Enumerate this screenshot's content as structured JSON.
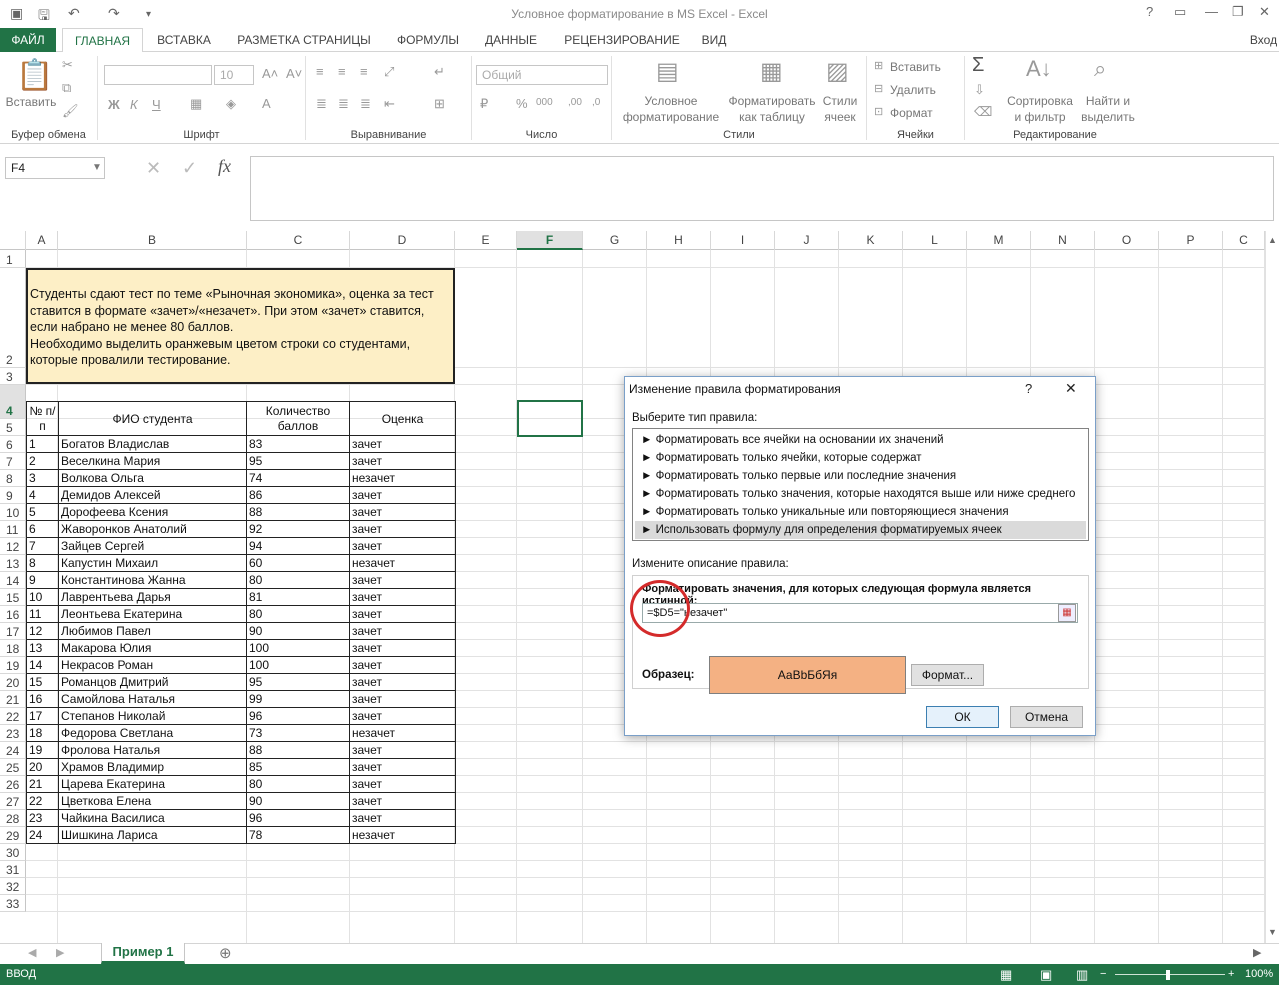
{
  "window": {
    "title": "Условное форматирование в MS Excel - Excel",
    "signin": "Вход"
  },
  "tabs": [
    "ФАЙЛ",
    "ГЛАВНАЯ",
    "ВСТАВКА",
    "РАЗМЕТКА СТРАНИЦЫ",
    "ФОРМУЛЫ",
    "ДАННЫЕ",
    "РЕЦЕНЗИРОВАНИЕ",
    "ВИД"
  ],
  "ribbon": {
    "paste": "Вставить",
    "font_size": "10",
    "number_format": "Общий",
    "cond_format": [
      "Условное",
      "форматирование"
    ],
    "format_table": [
      "Форматировать",
      "как таблицу"
    ],
    "cell_styles": [
      "Стили",
      "ячеек"
    ],
    "insert": "Вставить",
    "delete": "Удалить",
    "format": "Формат",
    "sort_filter": [
      "Сортировка",
      "и фильтр"
    ],
    "find_select": [
      "Найти и",
      "выделить"
    ],
    "bold": "Ж",
    "italic": "К",
    "underline": "Ч",
    "groups": [
      "Буфер обмена",
      "Шрифт",
      "Выравнивание",
      "Число",
      "Стили",
      "Ячейки",
      "Редактирование"
    ]
  },
  "namebox": "F4",
  "fx": "fx",
  "columns": [
    "A",
    "B",
    "C",
    "D",
    "E",
    "F",
    "G",
    "H",
    "I",
    "J",
    "K",
    "L",
    "M",
    "N",
    "O",
    "P",
    "C"
  ],
  "rows": [
    "1",
    "2",
    "3",
    "4",
    "5",
    "6",
    "7",
    "8",
    "9",
    "10",
    "11",
    "12",
    "13",
    "14",
    "15",
    "16",
    "17",
    "18",
    "19",
    "20",
    "21",
    "22",
    "23",
    "24",
    "25",
    "26",
    "27",
    "28",
    "29",
    "30",
    "31",
    "32",
    "33"
  ],
  "note": {
    "line1": "Студенты сдают тест по теме «Рыночная экономика», оценка за тест",
    "line2": "ставится в формате «зачет»/«незачет». При этом «зачет» ставится,",
    "line3": "если набрано не менее 80 баллов.",
    "line4": "Необходимо выделить оранжевым цветом строки со студентами,",
    "line5": "которые провалили тестирование."
  },
  "table": {
    "headers": {
      "num": "№ п/п",
      "name": "ФИО студента",
      "score": "Количество баллов",
      "grade": "Оценка"
    },
    "rows": [
      [
        "1",
        "Богатов Владислав",
        "83",
        "зачет"
      ],
      [
        "2",
        "Веселкина Мария",
        "95",
        "зачет"
      ],
      [
        "3",
        "Волкова Ольга",
        "74",
        "незачет"
      ],
      [
        "4",
        "Демидов Алексей",
        "86",
        "зачет"
      ],
      [
        "5",
        "Дорофеева Ксения",
        "88",
        "зачет"
      ],
      [
        "6",
        "Жаворонков Анатолий",
        "92",
        "зачет"
      ],
      [
        "7",
        "Зайцев Сергей",
        "94",
        "зачет"
      ],
      [
        "8",
        "Капустин Михаил",
        "60",
        "незачет"
      ],
      [
        "9",
        "Константинова Жанна",
        "80",
        "зачет"
      ],
      [
        "10",
        "Лаврентьева Дарья",
        "81",
        "зачет"
      ],
      [
        "11",
        "Леонтьева Екатерина",
        "80",
        "зачет"
      ],
      [
        "12",
        "Любимов Павел",
        "90",
        "зачет"
      ],
      [
        "13",
        "Макарова Юлия",
        "100",
        "зачет"
      ],
      [
        "14",
        "Некрасов Роман",
        "100",
        "зачет"
      ],
      [
        "15",
        "Романцов Дмитрий",
        "95",
        "зачет"
      ],
      [
        "16",
        "Самойлова Наталья",
        "99",
        "зачет"
      ],
      [
        "17",
        "Степанов Николай",
        "96",
        "зачет"
      ],
      [
        "18",
        "Федорова Светлана",
        "73",
        "незачет"
      ],
      [
        "19",
        "Фролова Наталья",
        "88",
        "зачет"
      ],
      [
        "20",
        "Храмов Владимир",
        "85",
        "зачет"
      ],
      [
        "21",
        "Царева Екатерина",
        "80",
        "зачет"
      ],
      [
        "22",
        "Цветкова Елена",
        "90",
        "зачет"
      ],
      [
        "23",
        "Чайкина Василиса",
        "96",
        "зачет"
      ],
      [
        "24",
        "Шишкина Лариса",
        "78",
        "незачет"
      ]
    ]
  },
  "dialog": {
    "title": "Изменение правила форматирования",
    "help": "?",
    "close": "✕",
    "select_type_label": "Выберите тип правила:",
    "rule_types": [
      "► Форматировать все ячейки на основании их значений",
      "► Форматировать только ячейки, которые содержат",
      "► Форматировать только первые или последние значения",
      "► Форматировать только значения, которые находятся выше или ниже среднего",
      "► Форматировать только уникальные или повторяющиеся значения",
      "► Использовать формулу для определения форматируемых ячеек"
    ],
    "edit_desc_label": "Измените описание правила:",
    "formula_label": "Форматировать значения, для которых следующая формула является истинной:",
    "formula": "=$D5=\"незачет\"",
    "preview_label": "Образец:",
    "preview_text": "АаВbБбЯя",
    "format_button": "Формат...",
    "ok": "ОК",
    "cancel": "Отмена"
  },
  "sheet_tab": "Пример 1",
  "status": {
    "mode": "ВВОД",
    "zoom": "100%"
  },
  "colors": {
    "accent": "#217346",
    "note_bg": "#fdefc6",
    "preview_bg": "#f4b183",
    "circle": "#d42b2b"
  }
}
